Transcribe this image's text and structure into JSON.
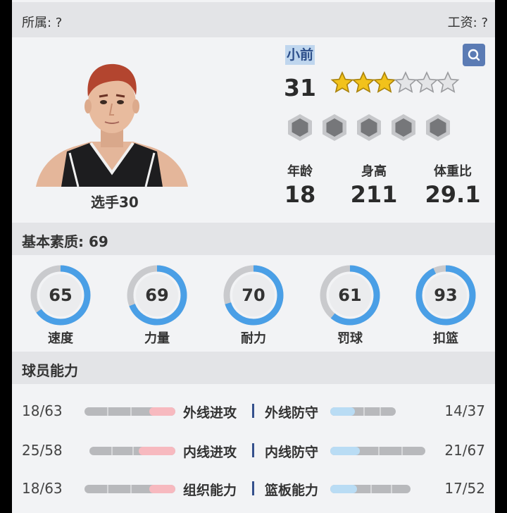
{
  "header": {
    "team_label": "所属: ?",
    "salary_label": "工资: ?"
  },
  "player": {
    "name": "选手30",
    "position": "小前",
    "rating": "31",
    "stars_filled": 3,
    "stars_total": 6,
    "badge_count": 5,
    "age_label": "年龄",
    "age": "18",
    "height_label": "身高",
    "height": "211",
    "weight_ratio_label": "体重比",
    "weight_ratio": "29.1"
  },
  "basic": {
    "title": "基本素质: 69",
    "attributes": [
      {
        "label": "速度",
        "value": "65",
        "fraction": 0.65
      },
      {
        "label": "力量",
        "value": "69",
        "fraction": 0.69
      },
      {
        "label": "耐力",
        "value": "70",
        "fraction": 0.7
      },
      {
        "label": "罚球",
        "value": "61",
        "fraction": 0.61
      },
      {
        "label": "扣篮",
        "value": "93",
        "fraction": 0.93
      }
    ]
  },
  "abilities": {
    "title": "球员能力",
    "rows": [
      {
        "left_value": "18/63",
        "left_label": "外线进攻",
        "left_fill": 0.29,
        "right_label": "外线防守",
        "right_value": "14/37",
        "right_fill": 0.38
      },
      {
        "left_value": "25/58",
        "left_label": "内线进攻",
        "left_fill": 0.43,
        "right_label": "内线防守",
        "right_value": "21/67",
        "right_fill": 0.31
      },
      {
        "left_value": "18/63",
        "left_label": "组织能力",
        "left_fill": 0.29,
        "right_label": "篮板能力",
        "right_value": "17/52",
        "right_fill": 0.33
      }
    ]
  },
  "colors": {
    "ring_blue": "#4a9fe6",
    "ring_gray": "#c9cacd",
    "bar_red": "#f7b9bf",
    "bar_blue": "#b9dcf4",
    "star_gold": "#f2c21b",
    "accent_blue": "#5b7bb4"
  },
  "icons": {
    "search": "search-icon",
    "star": "star-icon",
    "badge": "hexagon-badge-icon"
  }
}
